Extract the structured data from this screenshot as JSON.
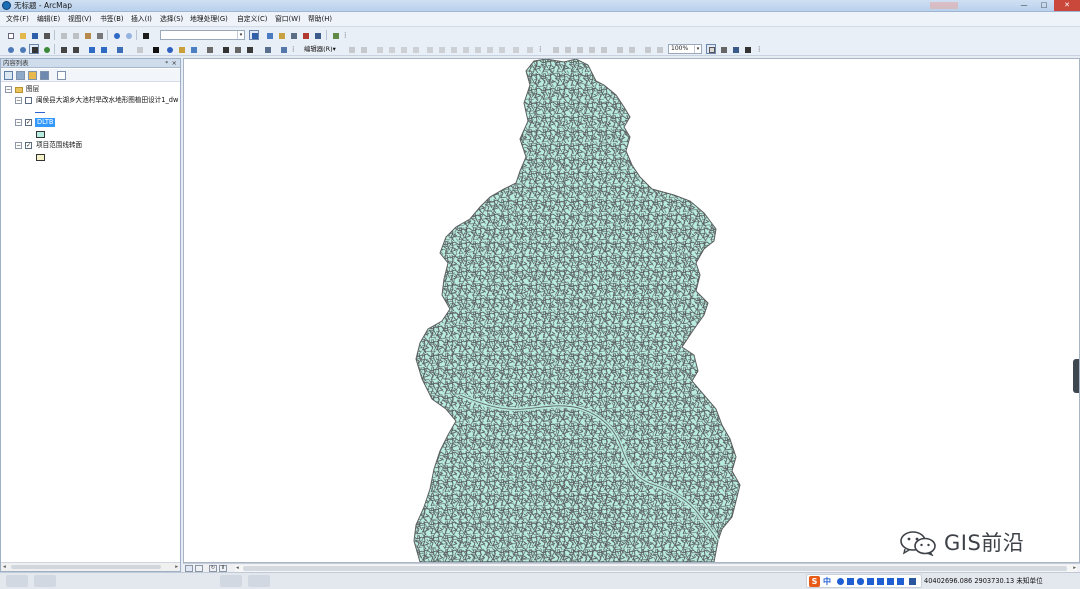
{
  "window": {
    "title": "无标题 - ArcMap",
    "minimize": "—",
    "maximize": "□",
    "close": "✕"
  },
  "menu": [
    "文件(F)",
    "编辑(E)",
    "视图(V)",
    "书签(B)",
    "插入(I)",
    "选择(S)",
    "地理处理(G)",
    "自定义(C)",
    "窗口(W)",
    "帮助(H)"
  ],
  "toolbar": {
    "scale_value": "",
    "editor_label": "编辑器(R)▾",
    "zoom_percent": "100%"
  },
  "toc": {
    "title": "内容列表",
    "pin": "ᵠ",
    "close": "×",
    "root": "图层",
    "layers": [
      {
        "name": "闽侯县大湖乡大池村旱改水地形图植田设计1_dw",
        "checked": false,
        "symbol": "line"
      },
      {
        "name": "DLTB",
        "checked": true,
        "selected": true,
        "symbol": "polygon"
      },
      {
        "name": "项目范围线转面",
        "checked": true,
        "symbol": "polygon"
      }
    ],
    "expand_minus": "−",
    "checkmark": "✓"
  },
  "map": {
    "fill_color": "#b9ece0",
    "line_color": "#5a5e5e"
  },
  "status": {
    "coordinates": "40402696.086  2903730.13 未知单位",
    "ime_text": "中"
  },
  "watermark": {
    "text": "GIS前沿"
  },
  "icons": {
    "arrow_left": "◂",
    "arrow_right": "▸",
    "refresh": "↻",
    "pause": "Ⅱ",
    "menu_grip": "⋮"
  }
}
